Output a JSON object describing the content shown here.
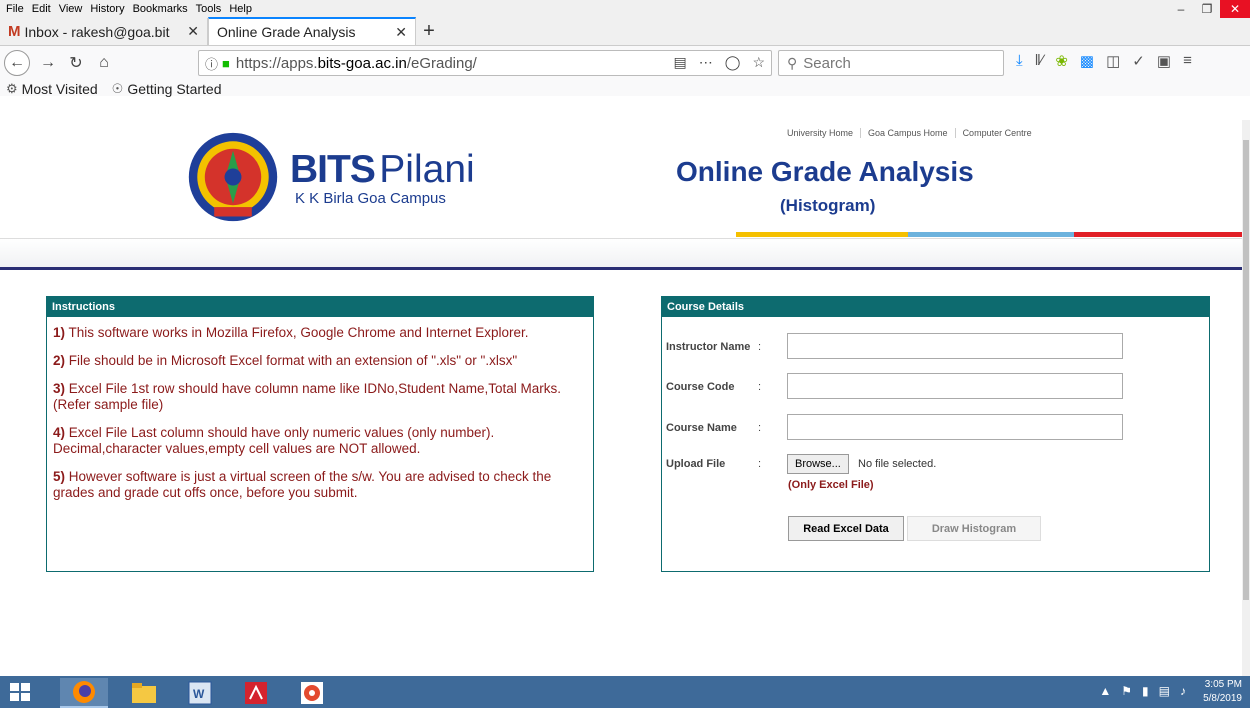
{
  "browser": {
    "menu": [
      "File",
      "Edit",
      "View",
      "History",
      "Bookmarks",
      "Tools",
      "Help"
    ],
    "tabs": [
      {
        "label": "Inbox - rakesh@goa.bit",
        "icon": "gmail-icon"
      },
      {
        "label": "Online Grade Analysis",
        "icon": ""
      }
    ],
    "url": {
      "prefix": "https://apps.",
      "domain": "bits-goa.ac.in",
      "path": "/eGrading/"
    },
    "search_placeholder": "Search",
    "bookmarks": [
      "Most Visited",
      "Getting Started"
    ],
    "colors": {
      "accent": "#0a84ff",
      "lock": "#12bc00"
    }
  },
  "site": {
    "toplinks": [
      "University Home",
      "Goa Campus Home",
      "Computer Centre"
    ],
    "brand_bits": "BITS",
    "brand_pilani": "Pilani",
    "brand_sub": "K K Birla Goa Campus",
    "title": "Online Grade Analysis",
    "subtitle": "(Histogram)",
    "colors": {
      "navy": "#1c3c8f",
      "teal": "#0d6b6f",
      "maroon": "#8b1a1a"
    }
  },
  "instructions": {
    "heading": "Instructions",
    "items": [
      {
        "num": "1)",
        "text": "This software works in Mozilla Firefox, Google Chrome and Internet Explorer."
      },
      {
        "num": "2)",
        "text": "File should be in Microsoft Excel format with an extension of \".xls\" or \".xlsx\""
      },
      {
        "num": "3)",
        "text": "Excel File 1st row should have column name like IDNo,Student Name,Total Marks.(Refer sample file)"
      },
      {
        "num": "4)",
        "text": "Excel File Last column should have only numeric values (only number). Decimal,character values,empty cell values are NOT allowed."
      },
      {
        "num": "5)",
        "text": "However software is just a virtual screen of the s/w. You are advised to check the grades and grade cut offs once, before you submit."
      }
    ]
  },
  "course": {
    "heading": "Course Details",
    "instructor_label": "Instructor Name",
    "code_label": "Course Code",
    "name_label": "Course Name",
    "upload_label": "Upload File",
    "colon": ":",
    "instructor_value": "",
    "code_value": "",
    "name_value": "",
    "browse_label": "Browse...",
    "no_file": "No file selected.",
    "only_excel": "(Only Excel File)",
    "read_button": "Read Excel Data",
    "draw_button": "Draw Histogram"
  },
  "taskbar": {
    "time": "3:05 PM",
    "date": "5/8/2019"
  }
}
